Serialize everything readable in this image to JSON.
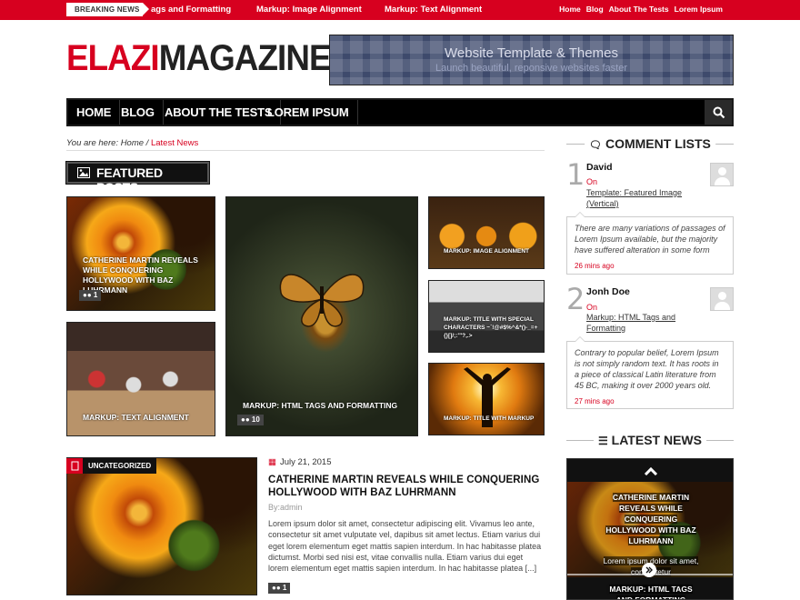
{
  "topbar": {
    "breaking_label": "BREAKING NEWS",
    "ticker": [
      "ags and Formatting",
      "Markup: Image Alignment",
      "Markup: Text Alignment"
    ],
    "links": [
      "Home",
      "Blog",
      "About The Tests",
      "Lorem Ipsum"
    ]
  },
  "header": {
    "logo_part1": "ELAZI",
    "logo_part2": "MAGAZINE",
    "banner_title": "Website Template & Themes",
    "banner_subtitle": "Launch beautiful, reponsive websites faster"
  },
  "nav": {
    "items": [
      "HOME",
      "BLOG",
      "ABOUT THE TESTS",
      "LOREM IPSUM"
    ],
    "search_icon": "search-icon"
  },
  "breadcrumb": {
    "prefix": "You are here:",
    "home": "Home",
    "sep": "/",
    "current": "Latest News"
  },
  "featured": {
    "heading": "FEATURED POSTS",
    "tiles": [
      {
        "caption": "CATHERINE MARTIN REVEALS WHILE CONQUERING HOLLYWOOD WITH BAZ LUHRMANN",
        "comments": "1"
      },
      {
        "caption": "MARKUP: TEXT ALIGNMENT"
      },
      {
        "caption": "MARKUP: HTML TAGS AND FORMATTING",
        "comments": "10"
      },
      {
        "caption": "MARKUP: IMAGE ALIGNMENT"
      },
      {
        "caption": "MARKUP: TITLE WITH SPECIAL CHARACTERS ~`!@#$%^&*()-_=+{}[]/;:'\"?,.>"
      },
      {
        "caption": "MARKUP: TITLE WITH MARKUP"
      }
    ]
  },
  "post": {
    "category": "UNCATEGORIZED",
    "date": "July 21, 2015",
    "title": "CATHERINE MARTIN REVEALS WHILE CONQUERING HOLLYWOOD WITH BAZ LUHRMANN",
    "by": "By:admin",
    "excerpt": "Lorem ipsum dolor sit amet, consectetur adipiscing elit. Vivamus leo ante, consectetur sit amet vulputate vel, dapibus sit amet lectus. Etiam varius dui eget lorem elementum eget mattis sapien interdum. In hac habitasse platea dictumst. Morbi sed nisi est, vitae convallis nulla. Etiam varius dui eget lorem elementum eget mattis sapien interdum. In hac habitasse platea [...]",
    "comments": "1"
  },
  "sidebar": {
    "comments_heading": "COMMENT LISTS",
    "comments": [
      {
        "num": "1",
        "name": "David",
        "on": "On",
        "link": "Template: Featured Image (Vertical)",
        "text": "There are many variations of passages of Lorem Ipsum available, but the majority have suffered alteration in some form",
        "ago": "26 mins ago"
      },
      {
        "num": "2",
        "name": "Jonh Doe",
        "on": "On",
        "link": "Markup: HTML Tags and Formatting",
        "text": "Contrary to popular belief, Lorem Ipsum is not simply random text. It has roots in a piece of classical Latin literature from 45 BC, making it over 2000 years old.",
        "ago": "27 mins ago"
      }
    ],
    "latest_heading": "LATEST NEWS",
    "latest": [
      {
        "title": "CATHERINE MARTIN REVEALS WHILE CONQUERING HOLLYWOOD WITH BAZ LUHRMANN",
        "snippet": "Lorem ipsum dolor sit amet, consectetur"
      },
      {
        "title": "MARKUP: HTML TAGS AND FORMATTING"
      }
    ]
  },
  "colors": {
    "accent": "#d7001f",
    "dark": "#111111"
  }
}
